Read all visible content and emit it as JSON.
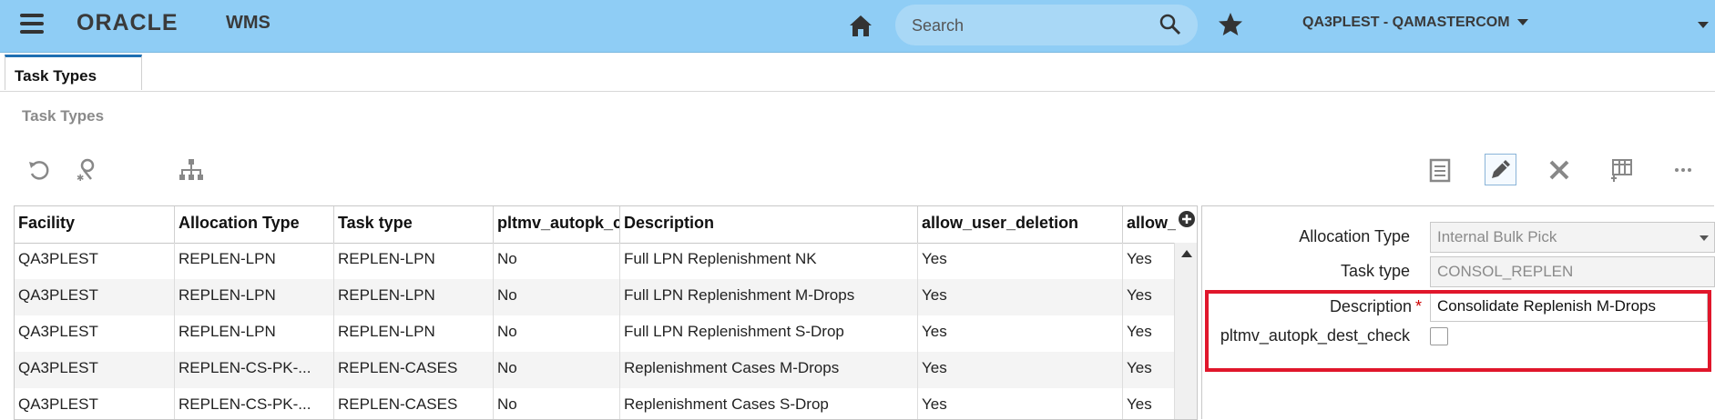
{
  "header": {
    "brand": "ORACLE",
    "app_name": "WMS",
    "search_placeholder": "Search",
    "user_context": "QA3PLEST - QAMASTERCOM"
  },
  "tabs": [
    {
      "label": "Task Types",
      "active": true
    }
  ],
  "page_title": "Task Types",
  "toolbar": {
    "left_icons": [
      "refresh-icon",
      "search-filter-icon",
      "hierarchy-icon"
    ],
    "right_icons": [
      "details-icon",
      "edit-icon",
      "delete-icon",
      "grid-settings-icon",
      "more-icon"
    ]
  },
  "grid": {
    "columns": [
      "Facility",
      "Allocation Type",
      "Task type",
      "pltmv_autopk_c",
      "Description",
      "allow_user_deletion",
      "allow_"
    ],
    "rows": [
      [
        "QA3PLEST",
        "REPLEN-LPN",
        "REPLEN-LPN",
        "No",
        "Full LPN Replenishment NK",
        "Yes",
        "Yes"
      ],
      [
        "QA3PLEST",
        "REPLEN-LPN",
        "REPLEN-LPN",
        "No",
        "Full LPN Replenishment M-Drops",
        "Yes",
        "Yes"
      ],
      [
        "QA3PLEST",
        "REPLEN-LPN",
        "REPLEN-LPN",
        "No",
        "Full LPN Replenishment S-Drop",
        "Yes",
        "Yes"
      ],
      [
        "QA3PLEST",
        "REPLEN-CS-PK-...",
        "REPLEN-CASES",
        "No",
        "Replenishment Cases M-Drops",
        "Yes",
        "Yes"
      ],
      [
        "QA3PLEST",
        "REPLEN-CS-PK-...",
        "REPLEN-CASES",
        "No",
        "Replenishment Cases S-Drop",
        "Yes",
        "Yes"
      ]
    ]
  },
  "detail": {
    "allocation_type_label": "Allocation Type",
    "allocation_type_value": "Internal Bulk Pick",
    "task_type_label": "Task type",
    "task_type_value": "CONSOL_REPLEN",
    "description_label": "Description",
    "required_marker": "*",
    "description_value": "Consolidate Replenish M-Drops",
    "dest_check_label": "pltmv_autopk_dest_check",
    "dest_check_checked": false
  },
  "colors": {
    "header_bg": "#8fcdf5",
    "highlight_border": "#e0162b",
    "active_tab_border": "#1f6fb2"
  }
}
